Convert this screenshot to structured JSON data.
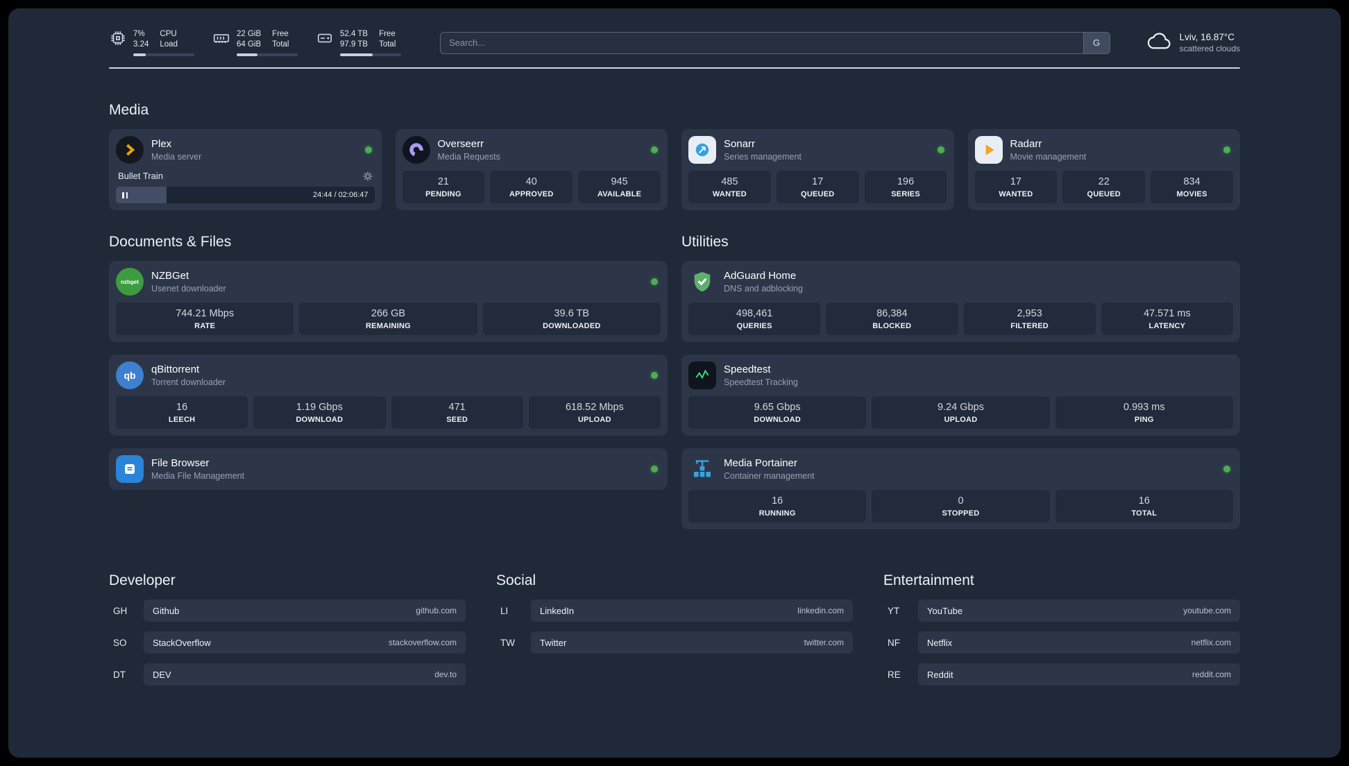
{
  "theme": {
    "status_green": "#4caf50",
    "accent_amber": "#e5a00d"
  },
  "topbar": {
    "cpu": {
      "icon": "cpu-icon",
      "values": [
        "7%",
        "3.24"
      ],
      "labels": [
        "CPU",
        "Load"
      ],
      "progress_pct": 20
    },
    "memory": {
      "icon": "memory-icon",
      "values": [
        "22 GiB",
        "64 GiB"
      ],
      "labels": [
        "Free",
        "Total"
      ],
      "progress_pct": 34
    },
    "disk": {
      "icon": "disk-icon",
      "values": [
        "52.4 TB",
        "97.9 TB"
      ],
      "labels": [
        "Free",
        "Total"
      ],
      "progress_pct": 53
    },
    "search": {
      "placeholder": "Search...",
      "button_label": "G"
    },
    "weather": {
      "icon": "cloud-icon",
      "location": "Lviv, 16.87°C",
      "condition": "scattered clouds"
    }
  },
  "media": {
    "title": "Media",
    "plex": {
      "icon": "plex-icon",
      "name": "Plex",
      "desc": "Media server",
      "online": true,
      "now_playing": "Bullet Train",
      "time": "24:44 / 02:06:47",
      "progress_pct": 19.5
    },
    "overseerr": {
      "icon": "overseerr-icon",
      "name": "Overseerr",
      "desc": "Media Requests",
      "online": true,
      "stats": [
        {
          "value": "21",
          "label": "PENDING"
        },
        {
          "value": "40",
          "label": "APPROVED"
        },
        {
          "value": "945",
          "label": "AVAILABLE"
        }
      ]
    },
    "sonarr": {
      "icon": "sonarr-icon",
      "name": "Sonarr",
      "desc": "Series management",
      "online": true,
      "stats": [
        {
          "value": "485",
          "label": "WANTED"
        },
        {
          "value": "17",
          "label": "QUEUED"
        },
        {
          "value": "196",
          "label": "SERIES"
        }
      ]
    },
    "radarr": {
      "icon": "radarr-icon",
      "name": "Radarr",
      "desc": "Movie management",
      "online": true,
      "stats": [
        {
          "value": "17",
          "label": "WANTED"
        },
        {
          "value": "22",
          "label": "QUEUED"
        },
        {
          "value": "834",
          "label": "MOVIES"
        }
      ]
    }
  },
  "documents": {
    "title": "Documents & Files",
    "nzbget": {
      "icon": "nzbget-icon",
      "icon_text": "nzbget",
      "name": "NZBGet",
      "desc": "Usenet downloader",
      "online": true,
      "stats": [
        {
          "value": "744.21 Mbps",
          "label": "RATE"
        },
        {
          "value": "266 GB",
          "label": "REMAINING"
        },
        {
          "value": "39.6 TB",
          "label": "DOWNLOADED"
        }
      ]
    },
    "qbittorrent": {
      "icon": "qbittorrent-icon",
      "icon_text": "qb",
      "name": "qBittorrent",
      "desc": "Torrent downloader",
      "online": true,
      "stats": [
        {
          "value": "16",
          "label": "LEECH"
        },
        {
          "value": "1.19 Gbps",
          "label": "DOWNLOAD"
        },
        {
          "value": "471",
          "label": "SEED"
        },
        {
          "value": "618.52 Mbps",
          "label": "UPLOAD"
        }
      ]
    },
    "filebrowser": {
      "icon": "filebrowser-icon",
      "name": "File Browser",
      "desc": "Media File Management",
      "online": true
    }
  },
  "utilities": {
    "title": "Utilities",
    "adguard": {
      "icon": "adguard-icon",
      "name": "AdGuard Home",
      "desc": "DNS and adblocking",
      "stats": [
        {
          "value": "498,461",
          "label": "QUERIES"
        },
        {
          "value": "86,384",
          "label": "BLOCKED"
        },
        {
          "value": "2,953",
          "label": "FILTERED"
        },
        {
          "value": "47.571 ms",
          "label": "LATENCY"
        }
      ]
    },
    "speedtest": {
      "icon": "speedtest-icon",
      "name": "Speedtest",
      "desc": "Speedtest Tracking",
      "stats": [
        {
          "value": "9.65 Gbps",
          "label": "DOWNLOAD"
        },
        {
          "value": "9.24 Gbps",
          "label": "UPLOAD"
        },
        {
          "value": "0.993 ms",
          "label": "PING"
        }
      ]
    },
    "portainer": {
      "icon": "portainer-icon",
      "name": "Media Portainer",
      "desc": "Container management",
      "online": true,
      "stats": [
        {
          "value": "16",
          "label": "RUNNING"
        },
        {
          "value": "0",
          "label": "STOPPED"
        },
        {
          "value": "16",
          "label": "TOTAL"
        }
      ]
    }
  },
  "bookmarks": {
    "developer": {
      "title": "Developer",
      "items": [
        {
          "abbr": "GH",
          "name": "Github",
          "url": "github.com"
        },
        {
          "abbr": "SO",
          "name": "StackOverflow",
          "url": "stackoverflow.com"
        },
        {
          "abbr": "DT",
          "name": "DEV",
          "url": "dev.to"
        }
      ]
    },
    "social": {
      "title": "Social",
      "items": [
        {
          "abbr": "LI",
          "name": "LinkedIn",
          "url": "linkedin.com"
        },
        {
          "abbr": "TW",
          "name": "Twitter",
          "url": "twitter.com"
        }
      ]
    },
    "entertainment": {
      "title": "Entertainment",
      "items": [
        {
          "abbr": "YT",
          "name": "YouTube",
          "url": "youtube.com"
        },
        {
          "abbr": "NF",
          "name": "Netflix",
          "url": "netflix.com"
        },
        {
          "abbr": "RE",
          "name": "Reddit",
          "url": "reddit.com"
        }
      ]
    }
  }
}
